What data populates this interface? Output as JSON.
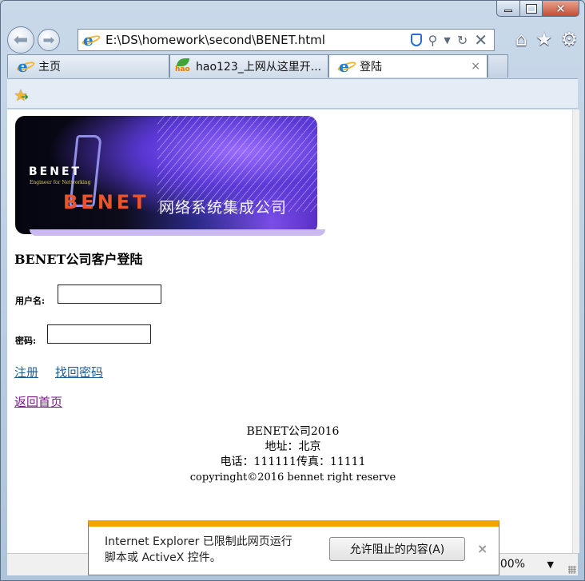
{
  "browser": {
    "address": "E:\\DS\\homework\\second\\BENET.html",
    "tabs": [
      {
        "label": "主页",
        "active": false
      },
      {
        "label": "hao123_上网从这里开...",
        "active": false
      },
      {
        "label": "登陆",
        "active": true
      }
    ],
    "tab_close": "×",
    "zoom": "100%"
  },
  "banner": {
    "benet_small": "BENET",
    "tagline": "Engineer for Networking",
    "benet_big": "BENET",
    "company": "网络系统集成公司"
  },
  "page": {
    "heading": "BENET公司客户登陆",
    "username_label": "用户名:",
    "username_value": "",
    "password_label": "密码:",
    "password_value": "",
    "register_link": "注册",
    "forgot_link": "找回密码",
    "home_link": "返回首页"
  },
  "footer": {
    "line1": "BENET公司2016",
    "line2": "地址：北京",
    "line3": "电话：111111传真：11111",
    "line4": "copyringht©2016 bennet right reserve"
  },
  "notification": {
    "text_line1": "Internet Explorer 已限制此网页运行",
    "text_line2": "脚本或 ActiveX 控件。",
    "button": "允许阻止的内容(A)",
    "close": "×"
  },
  "colors": {
    "accent_notify": "#f0a500",
    "link_blue": "#1b5b9a",
    "link_visited": "#7a1a8a",
    "banner_orange": "#e8542d"
  }
}
